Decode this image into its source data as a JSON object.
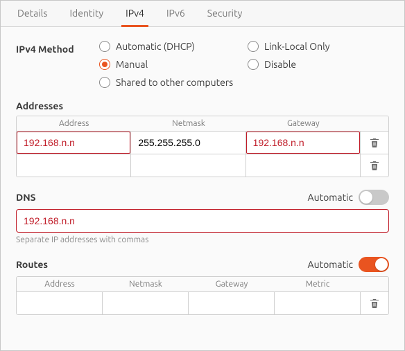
{
  "tabs": {
    "items": [
      "Details",
      "Identity",
      "IPv4",
      "IPv6",
      "Security"
    ],
    "active_index": 2
  },
  "method": {
    "label": "IPv4 Method",
    "options": {
      "auto": "Automatic (DHCP)",
      "link": "Link-Local Only",
      "manual": "Manual",
      "disable": "Disable",
      "shared": "Shared to other computers"
    },
    "selected": "manual"
  },
  "addresses": {
    "title": "Addresses",
    "headers": {
      "address": "Address",
      "netmask": "Netmask",
      "gateway": "Gateway"
    },
    "rows": [
      {
        "address": "192.168.n.n",
        "netmask": "255.255.255.0",
        "gateway": "192.168.n.n",
        "address_error": true,
        "gateway_error": true
      },
      {
        "address": "",
        "netmask": "",
        "gateway": "",
        "address_error": false,
        "gateway_error": false
      }
    ]
  },
  "dns": {
    "title": "DNS",
    "automatic_label": "Automatic",
    "automatic_on": false,
    "value": "192.168.n.n",
    "hint": "Separate IP addresses with commas"
  },
  "routes": {
    "title": "Routes",
    "automatic_label": "Automatic",
    "automatic_on": true,
    "headers": {
      "address": "Address",
      "netmask": "Netmask",
      "gateway": "Gateway",
      "metric": "Metric"
    },
    "rows": [
      {
        "address": "",
        "netmask": "",
        "gateway": "",
        "metric": ""
      }
    ]
  }
}
